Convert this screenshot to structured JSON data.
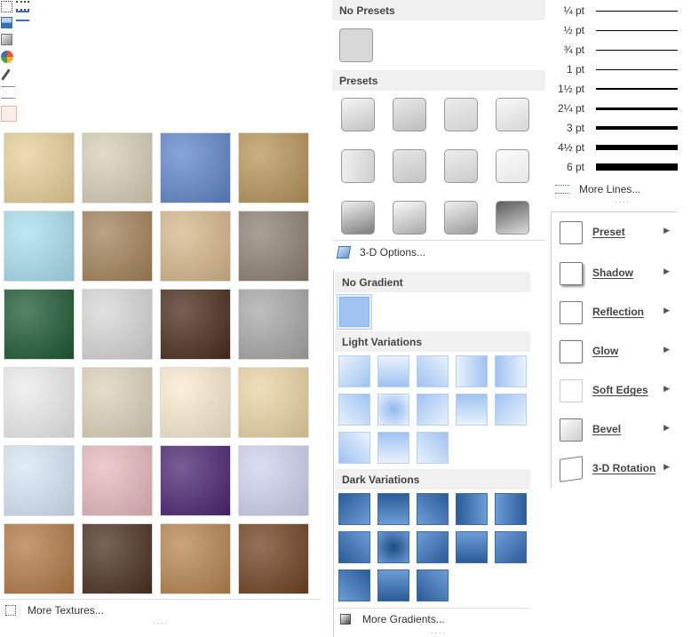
{
  "toolbar": {
    "icons": [
      "dashes-icon",
      "lines-icon",
      "picture-icon",
      "fill-icon",
      "color-wheel-icon",
      "eyedropper-icon",
      "arrows-icon",
      "swatch-icon"
    ]
  },
  "textures": {
    "more_label": "More Textures...",
    "colors": [
      [
        "#e9cf98",
        "#d9cfb9",
        "#5f86c9",
        "#b8955a"
      ],
      [
        "#a9dfef",
        "#a3835a",
        "#d7b78b",
        "#8d8174"
      ],
      [
        "#1d5a33",
        "#d7d7d7",
        "#4a2c1b",
        "#a8a8a8"
      ],
      [
        "#ececec",
        "#ddd2bc",
        "#f8ebcf",
        "#ead4a4"
      ],
      [
        "#d6e7f7",
        "#e7b9bd",
        "#4a2672",
        "#cfd2ef"
      ],
      [
        "#b37a45",
        "#4b3021",
        "#b7854f",
        "#6f4322"
      ]
    ]
  },
  "bevel": {
    "no_presets_label": "No Presets",
    "presets_label": "Presets",
    "options_label": "3-D Options..."
  },
  "gradients": {
    "no_gradient_label": "No Gradient",
    "light_label": "Light Variations",
    "dark_label": "Dark Variations",
    "more_label": "More Gradients..."
  },
  "line_weights": {
    "items": [
      {
        "label": "¼ pt",
        "thickness": 0.25
      },
      {
        "label": "½ pt",
        "thickness": 0.5
      },
      {
        "label": "¾ pt",
        "thickness": 0.75
      },
      {
        "label": "1 pt",
        "thickness": 1
      },
      {
        "label": "1½ pt",
        "thickness": 1.5
      },
      {
        "label": "2¼ pt",
        "thickness": 2.25
      },
      {
        "label": "3 pt",
        "thickness": 3
      },
      {
        "label": "4½ pt",
        "thickness": 4.5
      },
      {
        "label": "6 pt",
        "thickness": 6
      }
    ],
    "more_label": "More Lines..."
  },
  "effects": {
    "items": [
      "Preset",
      "Shadow",
      "Reflection",
      "Glow",
      "Soft Edges",
      "Bevel",
      "3-D Rotation"
    ]
  }
}
